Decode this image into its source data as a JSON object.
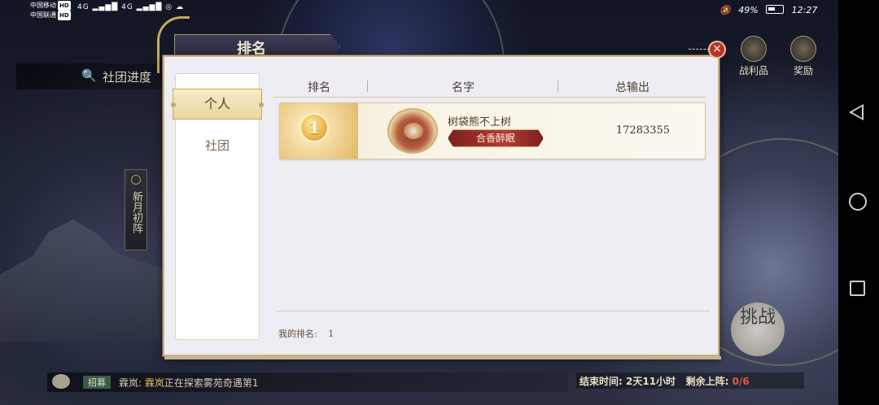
{
  "status_bar": {
    "carrier1": "中国移动",
    "carrier2": "中国联通",
    "hd": "HD",
    "network": "4G",
    "battery": "49%",
    "time": "12:27"
  },
  "background": {
    "guild_progress": "社团进度",
    "banner_text": "新月初阵",
    "loot_label": "战利品",
    "reward_label": "奖励",
    "challenge_label": "挑战",
    "chat_tag": "招募",
    "chat_name": "霖岚:",
    "chat_highlight": "霖岚",
    "chat_text": "正在探索雾苑奇遇第1",
    "end_time_label": "结束时间:",
    "end_time_value": "2天11小时",
    "remaining_label": "剩余上阵:",
    "remaining_value": "0/6"
  },
  "dialog": {
    "title": "排名",
    "close": "×",
    "tabs": [
      {
        "label": "个人",
        "active": true
      },
      {
        "label": "社团",
        "active": false
      }
    ],
    "columns": {
      "rank": "排名",
      "name": "名字",
      "output": "总输出"
    },
    "rows": [
      {
        "rank": "1",
        "name": "树袋熊不上树",
        "title": "合香醉眠",
        "output": "17283355"
      }
    ],
    "my_rank_label": "我的排名:",
    "my_rank_value": "1"
  },
  "colors": {
    "accent_gold": "#c9a862",
    "close_red": "#b8322b",
    "title_bar": "#2f3049"
  }
}
